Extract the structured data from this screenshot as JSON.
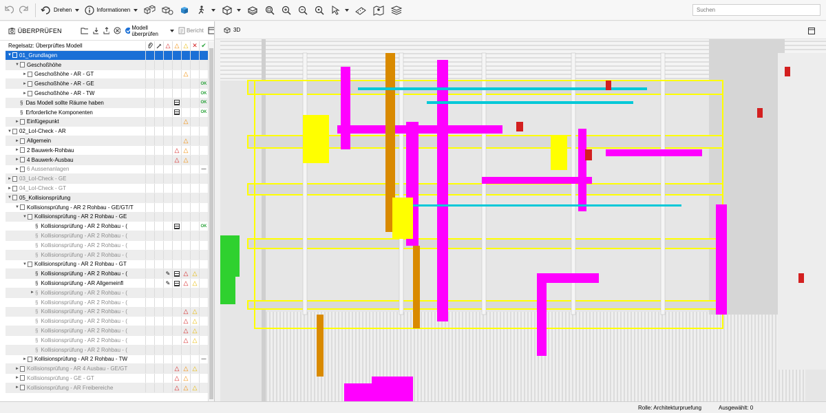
{
  "toolbar": {
    "rotate_label": "Drehen",
    "info_label": "Informationen",
    "search_placeholder": "Suchen"
  },
  "panel": {
    "title": "ÜBERPRÜFEN",
    "check_model_label": "Modell überprüfen",
    "report_label": "Bericht",
    "ruleset_label": "Regelsatz: Überprüftes Modell"
  },
  "view": {
    "title": "3D"
  },
  "tree": [
    {
      "label": "01_Grundlagen",
      "level": 0,
      "toggle": "▼",
      "type": "box",
      "selected": true
    },
    {
      "label": "Geschoßhöhe",
      "level": 1,
      "toggle": "▼",
      "type": "box"
    },
    {
      "label": "Geschoßhöhe - AR - GT",
      "level": 2,
      "toggle": "►",
      "type": "box",
      "c4": "orange"
    },
    {
      "label": "Geschoßhöhe - AR - GE",
      "level": 2,
      "toggle": "►",
      "type": "box",
      "c6": "ok"
    },
    {
      "label": "Geschoßhöhe - AR - TW",
      "level": 2,
      "toggle": "►",
      "type": "box",
      "c6": "ok"
    },
    {
      "label": "Das Modell sollte Räume haben",
      "level": 1,
      "toggle": "",
      "type": "para",
      "c3": "table",
      "c6": "ok"
    },
    {
      "label": "Erforderliche Komponenten",
      "level": 1,
      "toggle": "",
      "type": "para",
      "c3": "table",
      "c6": "ok"
    },
    {
      "label": "Einfügepunkt",
      "level": 1,
      "toggle": "►",
      "type": "box",
      "c4": "orange"
    },
    {
      "label": "02_LoI-Check - AR",
      "level": 0,
      "toggle": "▼",
      "type": "box"
    },
    {
      "label": "Allgemein",
      "level": 1,
      "toggle": "►",
      "type": "box",
      "c4": "orange"
    },
    {
      "label": "2 Bauwerk-Rohbau",
      "level": 1,
      "toggle": "►",
      "type": "box",
      "c3": "red",
      "c4": "orange"
    },
    {
      "label": "4 Bauwerk-Ausbau",
      "level": 1,
      "toggle": "►",
      "type": "box",
      "c3": "red",
      "c4": "orange"
    },
    {
      "label": "6 Aussenanlagen",
      "level": 1,
      "toggle": "►",
      "type": "box",
      "grey": true,
      "c6": "dash"
    },
    {
      "label": "03_LoI-Check - GE",
      "level": 0,
      "toggle": "►",
      "type": "box",
      "grey": true
    },
    {
      "label": "04_LoI-Check - GT",
      "level": 0,
      "toggle": "►",
      "type": "box",
      "grey": true
    },
    {
      "label": "05_Kollisionsprüfung",
      "level": 0,
      "toggle": "▼",
      "type": "box"
    },
    {
      "label": "Kollisionsprüfung - AR 2 Rohbau - GE/GT/T",
      "level": 1,
      "toggle": "▼",
      "type": "box"
    },
    {
      "label": "Kollisionsprüfung - AR 2 Rohbau - GE",
      "level": 2,
      "toggle": "▼",
      "type": "box"
    },
    {
      "label": "Kollisionsprüfung - AR 2 Rohbau - (",
      "level": 3,
      "toggle": "",
      "type": "para",
      "c3": "table",
      "c6": "ok"
    },
    {
      "label": "Kollisionsprüfung - AR 2 Rohbau - (",
      "level": 3,
      "toggle": "",
      "type": "para",
      "grey": true
    },
    {
      "label": "Kollisionsprüfung - AR 2 Rohbau - (",
      "level": 3,
      "toggle": "",
      "type": "para",
      "grey": true
    },
    {
      "label": "Kollisionsprüfung - AR 2 Rohbau - (",
      "level": 3,
      "toggle": "",
      "type": "para",
      "grey": true
    },
    {
      "label": "Kollisionsprüfung - AR 2 Rohbau - GT",
      "level": 2,
      "toggle": "▼",
      "type": "box"
    },
    {
      "label": "Kollisionsprüfung - AR 2 Rohbau - (",
      "level": 3,
      "toggle": "",
      "type": "para",
      "c2": "tools",
      "c3": "table",
      "c4": "red",
      "c5": "yellow"
    },
    {
      "label": "Kollisionsprüfung - AR Allgemeinfl",
      "level": 3,
      "toggle": "",
      "type": "para",
      "c2": "tools",
      "c3": "table",
      "c4": "red",
      "c5": "yellow"
    },
    {
      "label": "Kollisionsprüfung - AR 2 Rohbau - (",
      "level": 3,
      "toggle": "►",
      "type": "para",
      "grey": true
    },
    {
      "label": "Kollisionsprüfung - AR 2 Rohbau - (",
      "level": 3,
      "toggle": "",
      "type": "para",
      "grey": true
    },
    {
      "label": "Kollisionsprüfung - AR 2 Rohbau - (",
      "level": 3,
      "toggle": "",
      "type": "para",
      "grey": true,
      "c4": "red",
      "c5": "yellow"
    },
    {
      "label": "Kollisionsprüfung - AR 2 Rohbau - (",
      "level": 3,
      "toggle": "",
      "type": "para",
      "grey": true,
      "c4": "red",
      "c5": "yellow"
    },
    {
      "label": "Kollisionsprüfung - AR 2 Rohbau - (",
      "level": 3,
      "toggle": "",
      "type": "para",
      "grey": true,
      "c4": "red",
      "c5": "yellow"
    },
    {
      "label": "Kollisionsprüfung - AR 2 Rohbau - (",
      "level": 3,
      "toggle": "",
      "type": "para",
      "grey": true,
      "c4": "red",
      "c5": "yellow"
    },
    {
      "label": "Kollisionsprüfung - AR 2 Rohbau - (",
      "level": 3,
      "toggle": "",
      "type": "para",
      "grey": true
    },
    {
      "label": "Kollisionsprüfung - AR 2 Rohbau - TW",
      "level": 2,
      "toggle": "►",
      "type": "box",
      "c6": "dash"
    },
    {
      "label": "Kollisionsprüfung - AR 4 Ausbau - GE/GT",
      "level": 1,
      "toggle": "►",
      "type": "box",
      "grey": true,
      "c3": "red",
      "c4": "orange",
      "c5": "yellow"
    },
    {
      "label": "Kollisionsprüfung - GE - GT",
      "level": 1,
      "toggle": "►",
      "type": "box",
      "grey": true,
      "c3": "red",
      "c4": "orange"
    },
    {
      "label": "Kollisionsprüfung - AR Freibereiche",
      "level": 1,
      "toggle": "►",
      "type": "box",
      "grey": true,
      "c3": "red",
      "c4": "orange",
      "c5": "yellow"
    }
  ],
  "status": {
    "role": "Rolle: Architekturpruefung",
    "selected": "Ausgewählt: 0"
  },
  "colors": {
    "selection": "#1a6fd6",
    "duct_magenta": "#ff00ff",
    "structure_yellow": "#ffff00",
    "pipe_orange": "#d98a00",
    "pipe_cyan": "#00c8d8",
    "warning_red": "#d32020",
    "ok_green": "#2aa33a"
  }
}
